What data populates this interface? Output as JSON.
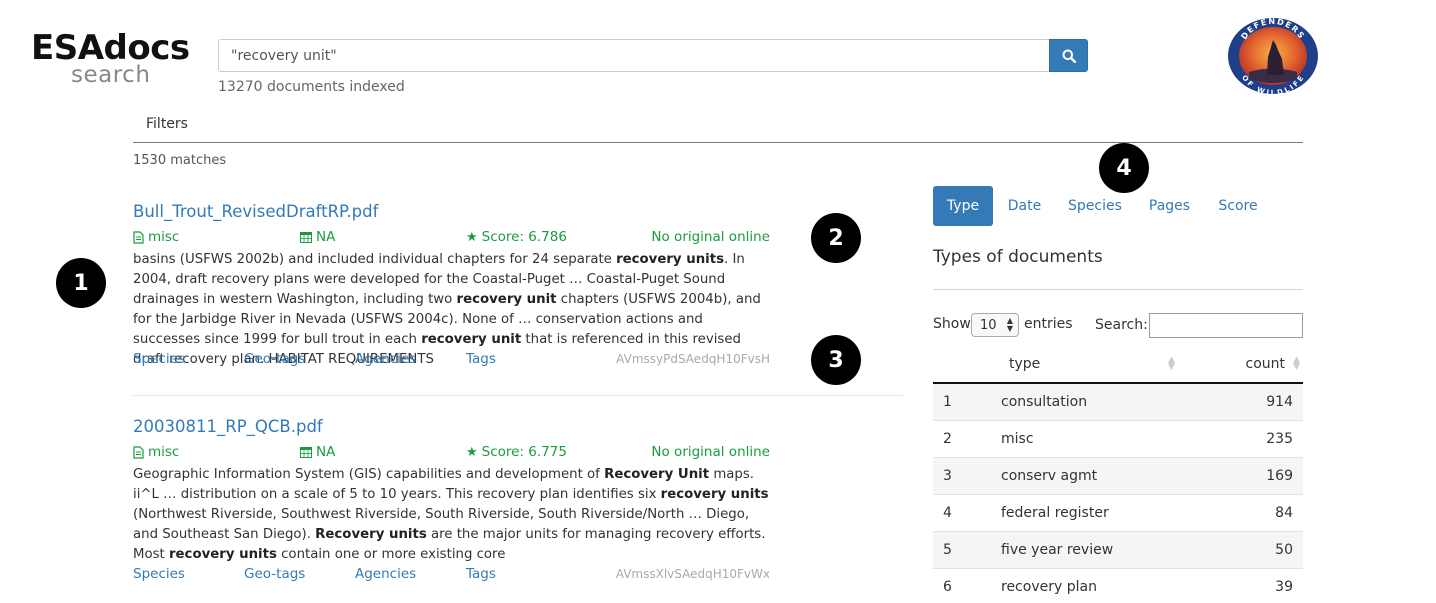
{
  "logo": {
    "main": "ESAdocs",
    "sub": "search"
  },
  "search": {
    "value": "\"recovery unit\"",
    "doc_count": "13270 documents indexed"
  },
  "filters": {
    "label": "Filters"
  },
  "results_summary": {
    "matches": "1530 matches"
  },
  "results": [
    {
      "title": "Bull_Trout_RevisedDraftRP.pdf",
      "type": "misc",
      "date": "NA",
      "score": "Score: 6.786",
      "availability": "No original online",
      "snippet_html": "basins (USFWS 2002b) and included individual chapters for 24 separate <b>recovery units</b>. In 2004, draft recovery plans were developed for the Coastal-Puget … Coastal-Puget Sound drainages in western Washington, including two <b>recovery unit</b> chapters (USFWS 2004b), and for the Jarbidge River in Nevada (USFWS 2004c). None of … conservation actions and successes since 1999 for bull trout in each <b>recovery unit</b> that is referenced in this revised draft recovery plan. HABITAT REQUIREMENTS",
      "links": [
        "Species",
        "Geo-tags",
        "Agencies",
        "Tags"
      ],
      "doc_id": "AVmssyPdSAedqH10FvsH"
    },
    {
      "title": "20030811_RP_QCB.pdf",
      "type": "misc",
      "date": "NA",
      "score": "Score: 6.775",
      "availability": "No original online",
      "snippet_html": "Geographic Information System (GIS) capabilities and development of <b>Recovery Unit</b> maps. ii^L … distribution on a scale of 5 to 10 years. This recovery plan identifies six <b>recovery units</b> (Northwest Riverside, Southwest Riverside, South Riverside, South Riverside/North … Diego, and Southeast San Diego). <b>Recovery units</b> are the major units for managing recovery efforts. Most <b>recovery units</b> contain one or more existing core",
      "links": [
        "Species",
        "Geo-tags",
        "Agencies",
        "Tags"
      ],
      "doc_id": "AVmssXlvSAedqH10FvWx"
    }
  ],
  "callouts": [
    "1",
    "2",
    "3",
    "4"
  ],
  "panel": {
    "tabs": [
      "Type",
      "Date",
      "Species",
      "Pages",
      "Score"
    ],
    "active_tab": "Type",
    "title": "Types of documents",
    "show_label": "Show",
    "page_size": "10",
    "entries_label": "entries",
    "search_label": "Search:",
    "columns": [
      "type",
      "count"
    ],
    "rows": [
      {
        "idx": "1",
        "type": "consultation",
        "count": "914"
      },
      {
        "idx": "2",
        "type": "misc",
        "count": "235"
      },
      {
        "idx": "3",
        "type": "conserv agmt",
        "count": "169"
      },
      {
        "idx": "4",
        "type": "federal register",
        "count": "84"
      },
      {
        "idx": "5",
        "type": "five year review",
        "count": "50"
      },
      {
        "idx": "6",
        "type": "recovery plan",
        "count": "39"
      }
    ]
  },
  "badge": {
    "top_text": "DEFENDERS",
    "bottom_text": "OF WILDLIFE"
  },
  "colors": {
    "link": "#337ab7",
    "meta_green": "#1a9c3e",
    "callout": "#000000"
  }
}
